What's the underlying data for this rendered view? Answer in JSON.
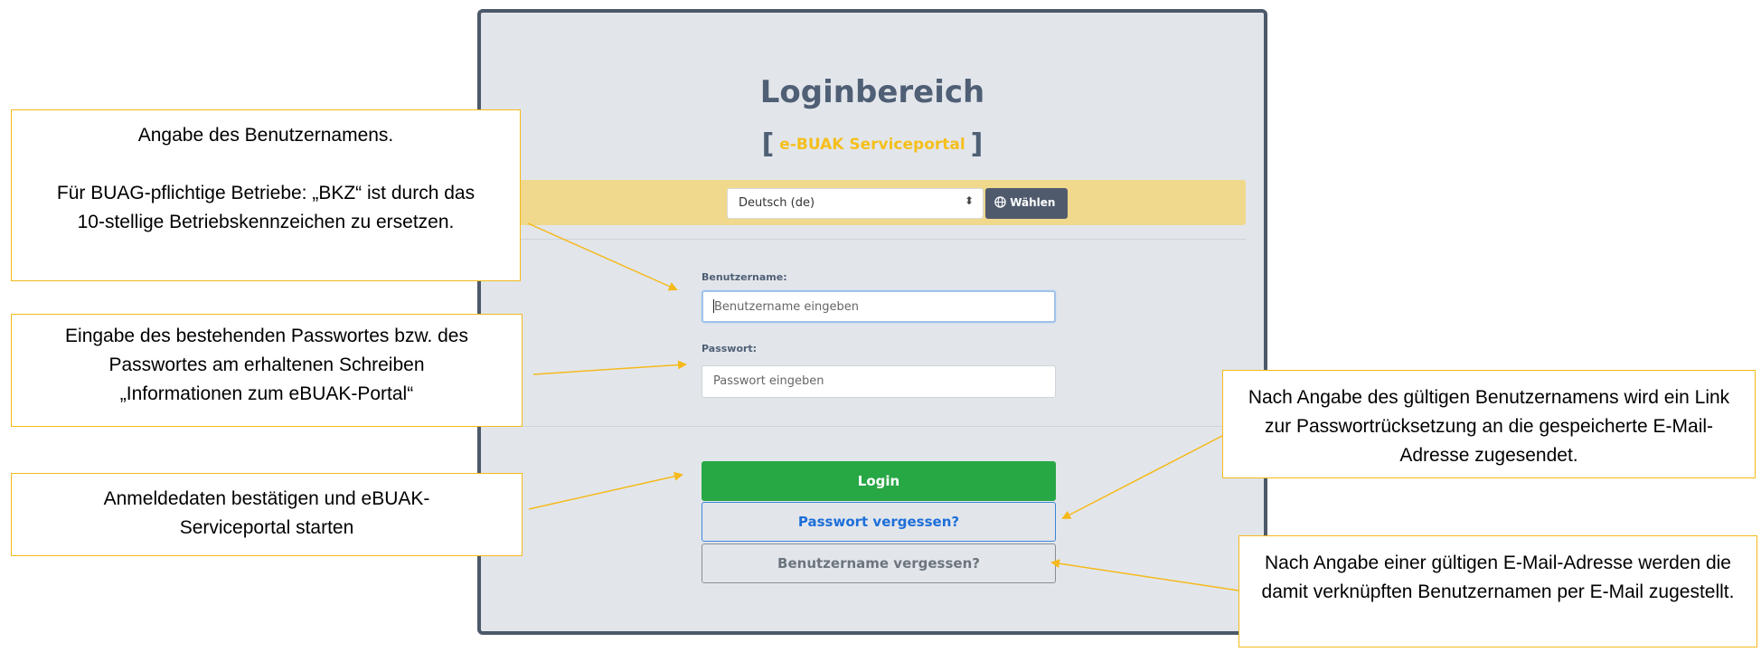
{
  "login": {
    "title": "Loginbereich",
    "subtitle_open": "[",
    "subtitle": "e-BUAK Serviceportal",
    "subtitle_close": "]",
    "language_value": "Deutsch (de)",
    "language_button": "Wählen",
    "username_label": "Benutzername:",
    "username_placeholder": "Benutzername eingeben",
    "password_label": "Passwort:",
    "password_placeholder": "Passwort eingeben",
    "login_button": "Login",
    "forgot_password_button": "Passwort vergessen?",
    "forgot_username_button": "Benutzername vergessen?"
  },
  "callouts": {
    "username_line1": "Angabe des Benutzernamens.",
    "username_line2": "Für BUAG-pflichtige Betriebe: „BKZ“ ist durch das 10-stellige Betriebskennzeichen zu ersetzen.",
    "password": "Eingabe des bestehenden Passwortes bzw. des Passwortes am erhaltenen Schreiben „Informationen zum eBUAK-Portal“",
    "login": "Anmeldedaten bestätigen und eBUAK-Serviceportal starten",
    "forgot_password": "Nach Angabe des gültigen Benutzernamens wird ein Link zur Passwortrücksetzung an die gespeicherte E-Mail-Adresse zugesendet.",
    "forgot_username": "Nach Angabe einer gültigen E-Mail-Adresse werden die damit verknüpften Benutzernamen per E-Mail zugestellt."
  },
  "colors": {
    "accent_yellow": "#f5bf1c",
    "login_green": "#28a745",
    "link_blue": "#1e6fd9",
    "panel_border": "#4c596a"
  }
}
